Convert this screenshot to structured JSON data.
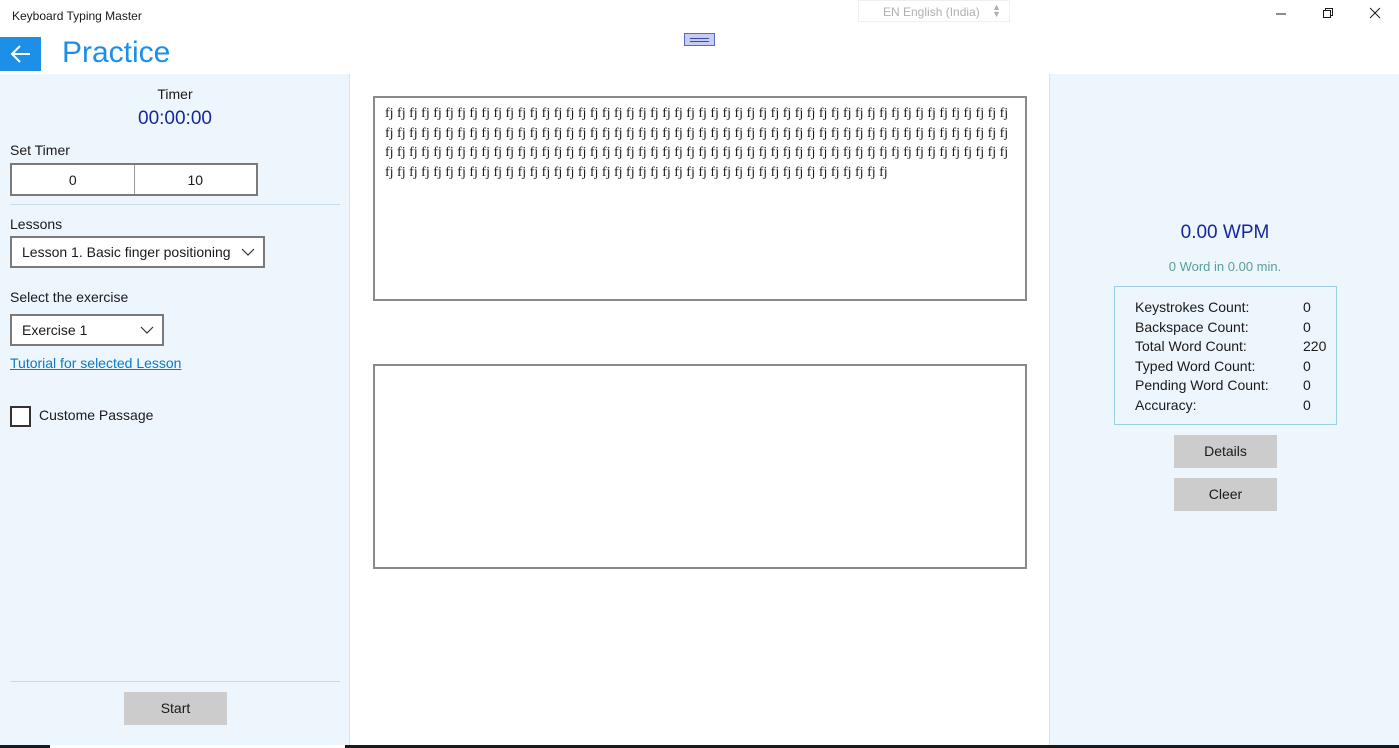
{
  "window": {
    "title": "Keyboard Typing Master",
    "language": "EN English (India)"
  },
  "header": {
    "page_title": "Practice"
  },
  "left": {
    "timer_label": "Timer",
    "timer_value": "00:00:00",
    "set_timer_label": "Set Timer",
    "timer_minutes": "0",
    "timer_seconds": "10",
    "lessons_label": "Lessons",
    "lesson_selected": "Lesson 1. Basic finger positioning",
    "exercise_label": "Select the exercise",
    "exercise_selected": "Exercise 1",
    "tutorial_link": "Tutorial for selected Lesson",
    "custom_passage_label": "Custome Passage",
    "custom_passage_checked": false,
    "start_label": "Start"
  },
  "center": {
    "passage": "fj fj fj fj fj fj fj fj fj fj fj fj fj fj fj fj fj fj fj fj fj fj fj fj fj fj fj fj fj fj fj fj fj fj fj fj fj fj fj fj fj fj fj fj fj fj fj fj fj fj fj fj fj fj fj fj fj fj fj fj fj fj fj fj fj fj fj fj fj fj fj fj fj fj fj fj fj fj fj fj fj fj fj fj fj fj fj fj fj fj fj fj fj fj fj fj fj fj fj fj fj fj fj fj fj fj fj fj fj fj fj fj fj fj fj fj fj fj fj fj fj fj fj fj fj fj fj fj fj fj fj fj fj fj fj fj fj fj fj fj fj fj fj fj fj fj fj fj fj fj fj fj fj fj fj fj fj fj fj fj fj fj fj fj fj fj fj fj fj fj fj fj fj fj fj fj fj fj fj fj fj fj fj fj fj fj fj fj fj fj fj fj fj fj fj fj fj fj",
    "typed_text": ""
  },
  "right": {
    "wpm": "0.00 WPM",
    "word_min": "0 Word in 0.00 min.",
    "stats": [
      {
        "label": "Keystrokes Count:",
        "value": "0"
      },
      {
        "label": "Backspace Count:",
        "value": "0"
      },
      {
        "label": "Total Word Count:",
        "value": "220"
      },
      {
        "label": "Typed Word Count:",
        "value": "0"
      },
      {
        "label": "Pending Word Count:",
        "value": "0"
      },
      {
        "label": "Accuracy:",
        "value": "0"
      }
    ],
    "details_label": "Details",
    "clear_label": "Cleer"
  },
  "colors": {
    "accent": "#1e8fe6",
    "value_blue": "#16279c",
    "panel_bg": "#eef6fd"
  }
}
